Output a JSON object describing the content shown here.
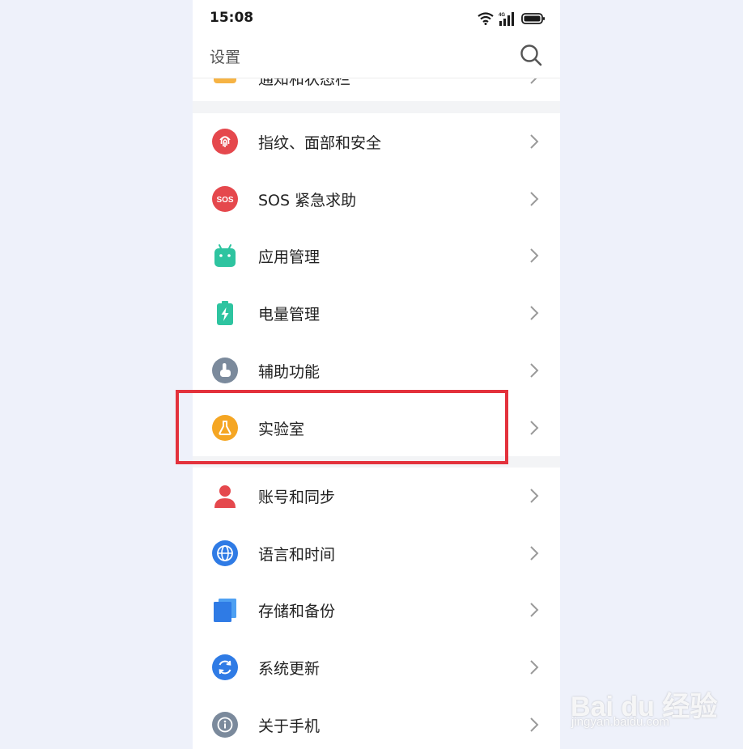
{
  "status_bar": {
    "time": "15:08",
    "network": "4G"
  },
  "header": {
    "title": "设置"
  },
  "partial_row": {
    "label": "通知和状态栏"
  },
  "group1": [
    {
      "label": "指纹、面部和安全",
      "icon": "fingerprint-icon",
      "color": "#e5484d"
    },
    {
      "label": "SOS 紧急求助",
      "icon": "sos-icon",
      "color": "#e5484d"
    },
    {
      "label": "应用管理",
      "icon": "android-icon",
      "color": "#2ec4a0"
    },
    {
      "label": "电量管理",
      "icon": "battery-icon",
      "color": "#2ec4a0"
    },
    {
      "label": "辅助功能",
      "icon": "hand-icon",
      "color": "#7b8a9c"
    },
    {
      "label": "实验室",
      "icon": "flask-icon",
      "color": "#f5a623"
    }
  ],
  "group2": [
    {
      "label": "账号和同步",
      "icon": "account-icon",
      "color": "#e5484d"
    },
    {
      "label": "语言和时间",
      "icon": "globe-icon",
      "color": "#2f7be5"
    },
    {
      "label": "存储和备份",
      "icon": "storage-icon",
      "color": "#2f7be5"
    },
    {
      "label": "系统更新",
      "icon": "update-icon",
      "color": "#2f7be5"
    },
    {
      "label": "关于手机",
      "icon": "info-icon",
      "color": "#7b8a9c"
    }
  ],
  "highlight_color": "#e3323c",
  "watermark": {
    "brand": "Bai du 经验",
    "url": "jingyan.baidu.com"
  }
}
